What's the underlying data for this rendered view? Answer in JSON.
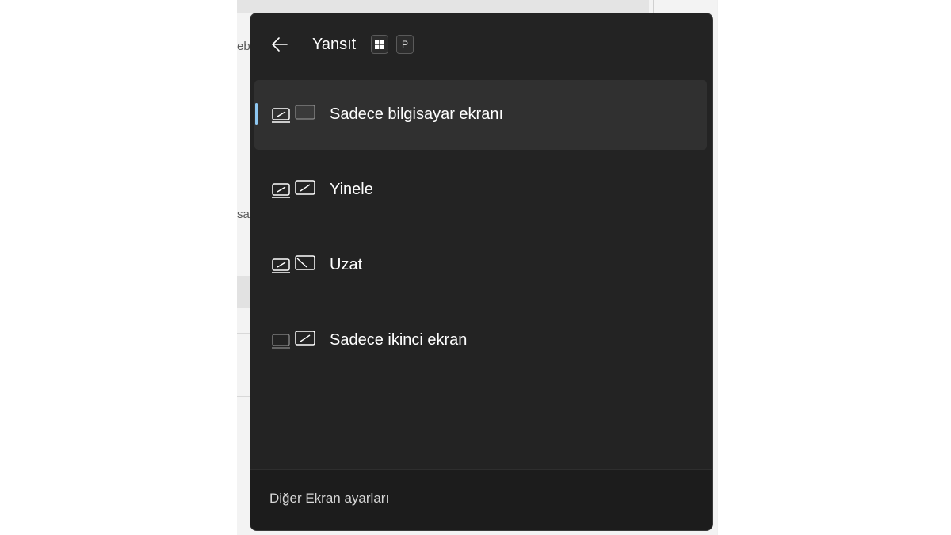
{
  "background": {
    "fragments": [
      "eb",
      "sa"
    ]
  },
  "flyout": {
    "title": "Yansıt",
    "back_icon": "arrow-left-icon",
    "shortcut_keys": [
      {
        "icon": "windows-key-icon",
        "label": ""
      },
      {
        "icon": "",
        "label": "P"
      }
    ],
    "options": [
      {
        "label": "Sadece bilgisayar ekranı",
        "icon": "pc-screen-only-icon",
        "selected": true
      },
      {
        "label": "Yinele",
        "icon": "duplicate-icon",
        "selected": false
      },
      {
        "label": "Uzat",
        "icon": "extend-icon",
        "selected": false
      },
      {
        "label": "Sadece ikinci ekran",
        "icon": "second-screen-only-icon",
        "selected": false
      }
    ],
    "footer_link": "Diğer Ekran ayarları"
  },
  "colors": {
    "panel_bg": "#232323",
    "selected_bg": "#303030",
    "accent": "#8ec7f1",
    "footer_bg": "#1c1c1c"
  }
}
